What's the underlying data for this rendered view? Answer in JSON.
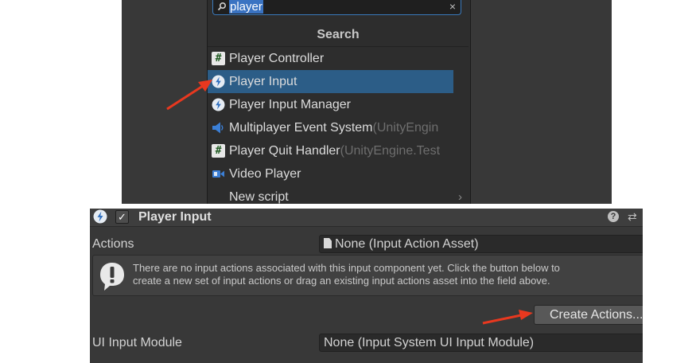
{
  "search": {
    "query": "player",
    "clear_glyph": "×",
    "header": "Search"
  },
  "results": [
    {
      "label": "Player Controller",
      "namespace": "",
      "icon": "csharp-script-icon",
      "selected": false
    },
    {
      "label": "Player Input",
      "namespace": "",
      "icon": "input-system-icon",
      "selected": true
    },
    {
      "label": "Player Input Manager",
      "namespace": "",
      "icon": "input-system-icon",
      "selected": false
    },
    {
      "label": "Multiplayer Event System",
      "namespace": "(UnityEngin",
      "icon": "event-system-icon",
      "selected": false
    },
    {
      "label": "Player Quit Handler",
      "namespace": "(UnityEngine.Test",
      "icon": "csharp-script-icon",
      "selected": false
    },
    {
      "label": "Video Player",
      "namespace": "",
      "icon": "video-player-icon",
      "selected": false
    },
    {
      "label": "New script",
      "namespace": "",
      "icon": "",
      "selected": false
    }
  ],
  "inspector": {
    "component_title": "Player Input",
    "toggle_glyph": "✓",
    "help_glyph": "?",
    "preset_glyph": "⇄",
    "actions_label": "Actions",
    "actions_value": "None (Input Action Asset)",
    "helpbox_text": "There are no input actions associated with this input component yet. Click the button below to\ncreate a new set of input actions or drag an existing input actions asset into the field above.",
    "create_button": "Create Actions...",
    "ui_module_label": "UI Input Module",
    "ui_module_value": "None (Input System UI Input Module)"
  },
  "colors": {
    "accent": "#3a73c2",
    "selection": "#2c5d87",
    "arrow": "#e8381f",
    "panel_bg": "#383838"
  }
}
